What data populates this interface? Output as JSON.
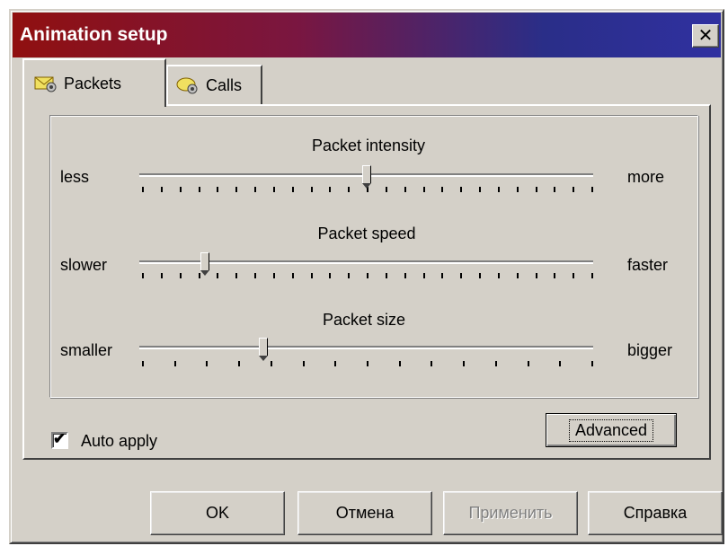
{
  "window": {
    "title": "Animation setup",
    "close_glyph": "✕"
  },
  "tabs": [
    {
      "label": "Packets",
      "icon": "packets-envelope-gear-icon",
      "active": true
    },
    {
      "label": "Calls",
      "icon": "calls-gear-icon",
      "active": false
    }
  ],
  "sliders": [
    {
      "title": "Packet intensity",
      "min_label": "less",
      "max_label": "more",
      "value_fraction": 0.5,
      "tick_count": 24
    },
    {
      "title": "Packet speed",
      "min_label": "slower",
      "max_label": "faster",
      "value_fraction": 0.14,
      "tick_count": 24
    },
    {
      "title": "Packet size",
      "min_label": "smaller",
      "max_label": "bigger",
      "value_fraction": 0.27,
      "tick_count": 14
    }
  ],
  "auto_apply": {
    "label": "Auto apply",
    "checked": true
  },
  "buttons": {
    "advanced": "Advanced",
    "ok": "OK",
    "cancel": "Отмена",
    "apply": "Применить",
    "help": "Справка"
  },
  "colors": {
    "face": "#d4d0c8",
    "title_gradient_start": "#901010",
    "title_gradient_end": "#3030a0"
  }
}
